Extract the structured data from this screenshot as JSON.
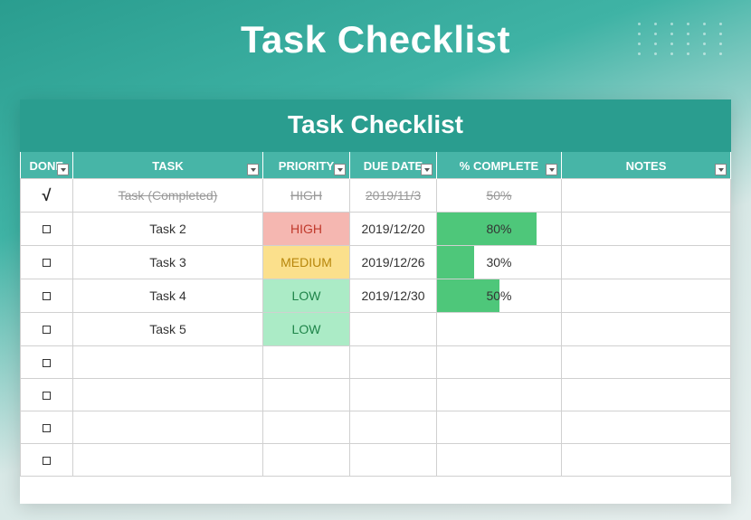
{
  "page": {
    "title": "Task Checklist"
  },
  "sheet": {
    "title": "Task Checklist"
  },
  "columns": {
    "done": "DONE",
    "task": "TASK",
    "priority": "PRIORITY",
    "duedate": "DUE DATE",
    "complete": "% COMPLETE",
    "notes": "NOTES"
  },
  "rows": [
    {
      "done": true,
      "task": "Task (Completed)",
      "priority": "HIGH",
      "priority_level": "high",
      "due_date": "2019/11/3",
      "pct": 50,
      "pct_label": "50%",
      "notes": "",
      "completed": true
    },
    {
      "done": false,
      "task": "Task 2",
      "priority": "HIGH",
      "priority_level": "high",
      "due_date": "2019/12/20",
      "pct": 80,
      "pct_label": "80%",
      "notes": "",
      "completed": false
    },
    {
      "done": false,
      "task": "Task 3",
      "priority": "MEDIUM",
      "priority_level": "medium",
      "due_date": "2019/12/26",
      "pct": 30,
      "pct_label": "30%",
      "notes": "",
      "completed": false
    },
    {
      "done": false,
      "task": "Task 4",
      "priority": "LOW",
      "priority_level": "low",
      "due_date": "2019/12/30",
      "pct": 50,
      "pct_label": "50%",
      "notes": "",
      "completed": false
    },
    {
      "done": false,
      "task": "Task 5",
      "priority": "LOW",
      "priority_level": "low",
      "due_date": "",
      "pct": null,
      "pct_label": "",
      "notes": "",
      "completed": false
    },
    {
      "done": false,
      "task": "",
      "priority": "",
      "priority_level": "",
      "due_date": "",
      "pct": null,
      "pct_label": "",
      "notes": "",
      "completed": false
    },
    {
      "done": false,
      "task": "",
      "priority": "",
      "priority_level": "",
      "due_date": "",
      "pct": null,
      "pct_label": "",
      "notes": "",
      "completed": false
    },
    {
      "done": false,
      "task": "",
      "priority": "",
      "priority_level": "",
      "due_date": "",
      "pct": null,
      "pct_label": "",
      "notes": "",
      "completed": false
    },
    {
      "done": false,
      "task": "",
      "priority": "",
      "priority_level": "",
      "due_date": "",
      "pct": null,
      "pct_label": "",
      "notes": "",
      "completed": false
    }
  ],
  "chart_data": {
    "type": "table",
    "title": "Task Checklist",
    "columns": [
      "DONE",
      "TASK",
      "PRIORITY",
      "DUE DATE",
      "% COMPLETE",
      "NOTES"
    ],
    "rows": [
      [
        "✓",
        "Task (Completed)",
        "HIGH",
        "2019/11/3",
        "50%",
        ""
      ],
      [
        "",
        "Task 2",
        "HIGH",
        "2019/12/20",
        "80%",
        ""
      ],
      [
        "",
        "Task 3",
        "MEDIUM",
        "2019/12/26",
        "30%",
        ""
      ],
      [
        "",
        "Task 4",
        "LOW",
        "2019/12/30",
        "50%",
        ""
      ],
      [
        "",
        "Task 5",
        "LOW",
        "",
        "",
        ""
      ]
    ]
  }
}
